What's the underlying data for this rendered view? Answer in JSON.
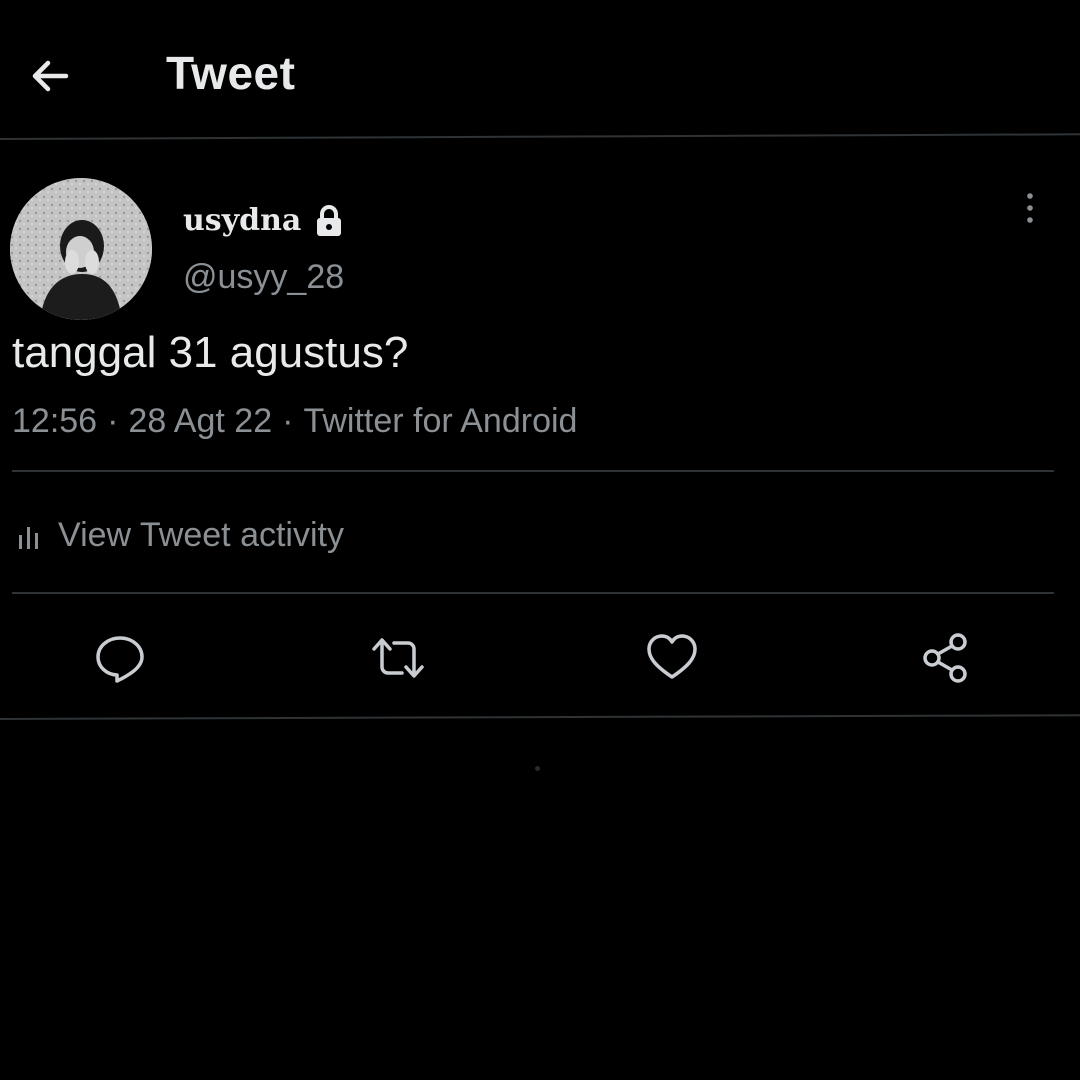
{
  "header": {
    "title": "Tweet",
    "back_icon": "arrow-left-icon"
  },
  "tweet": {
    "author": {
      "display_name": "usydna",
      "handle": "@usyy_28",
      "protected_icon": "lock-icon",
      "avatar": "avatar"
    },
    "text": "tanggal 31 agustus?",
    "time": "12:56",
    "date": "28 Agt 22",
    "source": "Twitter for Android",
    "separator": "·",
    "more_icon": "more-vertical-icon"
  },
  "activity": {
    "label": "View Tweet activity",
    "icon": "bar-chart-icon"
  },
  "actions": [
    {
      "name": "reply",
      "icon": "reply-icon"
    },
    {
      "name": "retweet",
      "icon": "retweet-icon"
    },
    {
      "name": "like",
      "icon": "heart-icon"
    },
    {
      "name": "share",
      "icon": "share-icon"
    }
  ],
  "colors": {
    "background": "#000000",
    "primary_text": "#e7e9ea",
    "secondary_text": "#8b9095",
    "divider": "#2f3336"
  }
}
